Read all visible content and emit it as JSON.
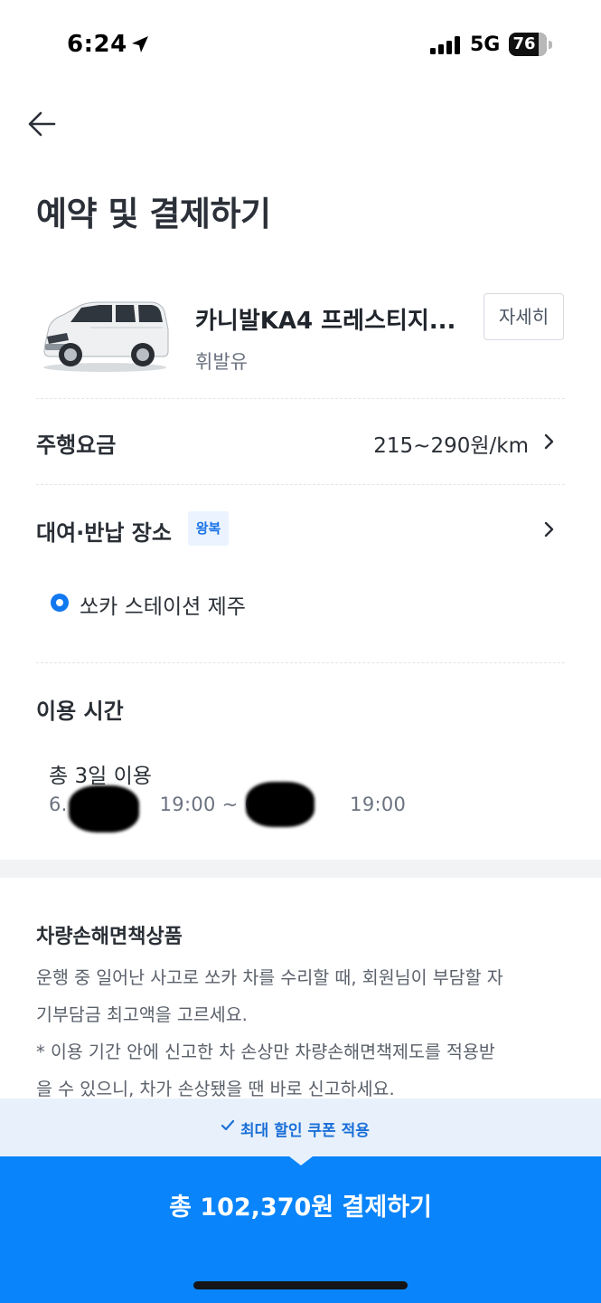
{
  "status_bar": {
    "time": "6:24",
    "network": "5G",
    "battery": "76"
  },
  "header": {
    "title": "예약 및 결제하기"
  },
  "car": {
    "name": "카니발KA4 프레스티지...",
    "fuel": "휘발유",
    "detail_button": "자세히"
  },
  "fare": {
    "label": "주행요금",
    "value": "215~290원/km"
  },
  "location": {
    "label": "대여·반납 장소",
    "badge": "왕복",
    "station": "쏘카 스테이션 제주"
  },
  "usage": {
    "title": "이용 시간",
    "total": "총 3일 이용",
    "start_prefix": "6.",
    "start_time": "19:00 ~ 6.",
    "end_time": "19:00"
  },
  "insurance": {
    "title": "차량손해면책상품",
    "line1": "운행 중 일어난 사고로 쏘카 차를 수리할 때, 회원님이 부담할 자",
    "line2": "기부담금 최고액을 고르세요.",
    "line3": "* 이용 기간 안에 신고한 차 손상만 차량손해면책제도를 적용받",
    "line4": "을 수 있으니, 차가 손상됐을 땐 바로 신고하세요."
  },
  "coupon": {
    "label": "최대 할인 쿠폰 적용"
  },
  "payment": {
    "button_label": "총 102,370원 결제하기"
  },
  "colors": {
    "accent": "#0a84fa",
    "coupon_bg": "#e8f1fb",
    "badge_bg": "#eaf3ff"
  }
}
